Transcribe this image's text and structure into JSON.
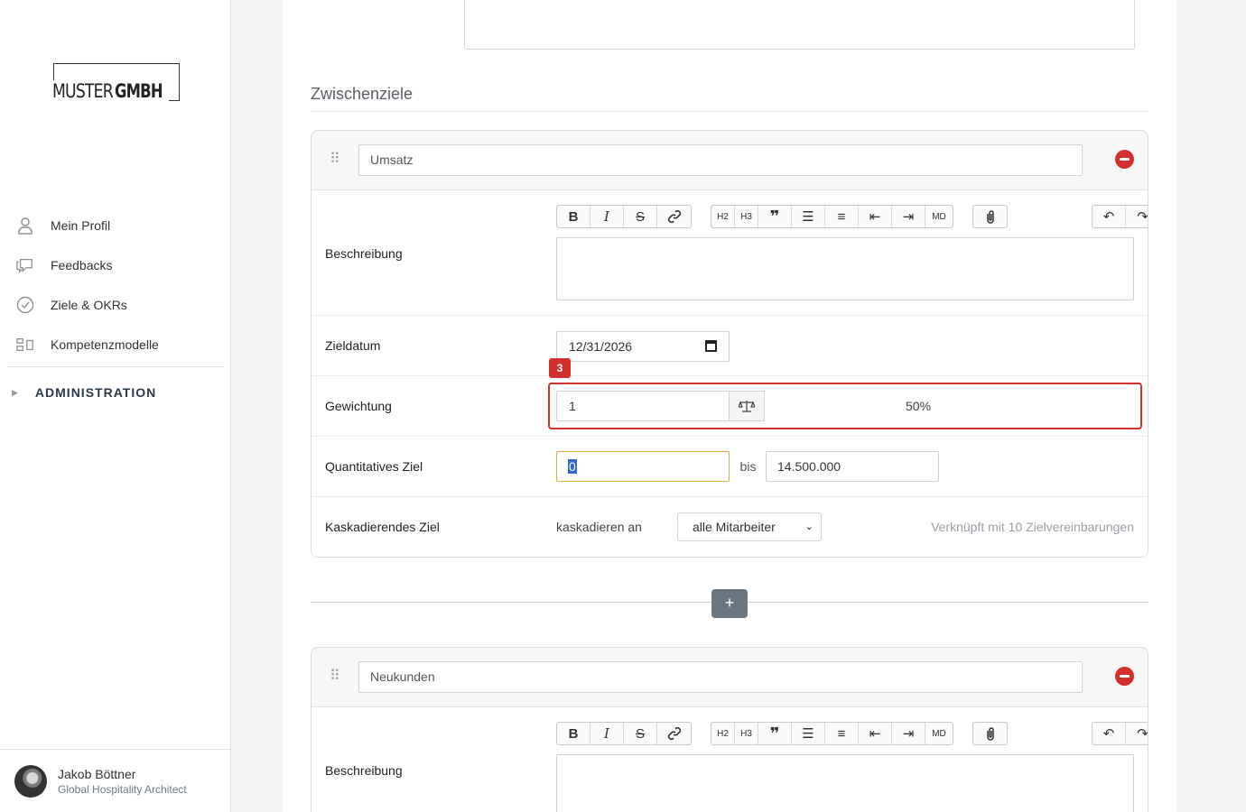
{
  "brand": {
    "light": "MUSTER",
    "bold": "GMBH"
  },
  "nav": [
    {
      "label": "Mein Profil",
      "icon": "user-icon"
    },
    {
      "label": "Feedbacks",
      "icon": "chat-icon"
    },
    {
      "label": "Ziele & OKRs",
      "icon": "check-circle-icon"
    },
    {
      "label": "Kompetenzmodelle",
      "icon": "grid-icon"
    }
  ],
  "admin_label": "ADMINISTRATION",
  "user": {
    "name": "Jakob Böttner",
    "role": "Global Hospitality Architect"
  },
  "section_title": "Zwischenziele",
  "labels": {
    "description": "Beschreibung",
    "target_date": "Zieldatum",
    "weighting": "Gewichtung",
    "quantitative": "Quantitatives Ziel",
    "cascading": "Kaskadierendes Ziel",
    "cascade_to": "kaskadieren an",
    "bis": "bis"
  },
  "toolbar": {
    "h2": "H2",
    "h3": "H3",
    "md": "MD"
  },
  "goals": [
    {
      "title": "Umsatz",
      "date": "12/31/2026",
      "weight": "1",
      "weight_pct": "50%",
      "quant_from": "0",
      "quant_to": "14.500.000",
      "cascade_select": "alle Mitarbeiter",
      "linked_info": "Verknüpft mit 10 Zielvereinbarungen"
    },
    {
      "title": "Neukunden"
    }
  ],
  "annotation": {
    "badge": "3"
  },
  "colors": {
    "danger": "#d32f2f",
    "selection": "#3466d4",
    "focus_border": "#e0b04a"
  }
}
